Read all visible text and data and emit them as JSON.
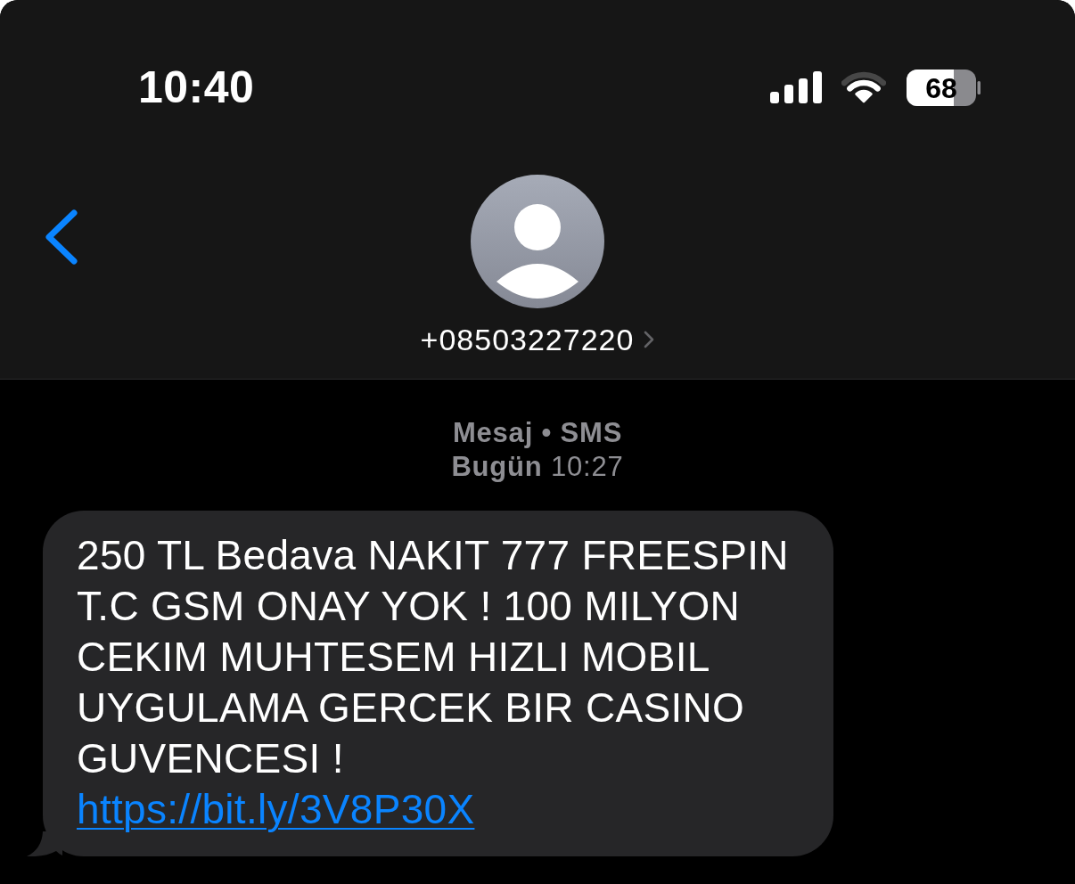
{
  "status_bar": {
    "time": "10:40",
    "battery": "68"
  },
  "header": {
    "contact": "+08503227220"
  },
  "conversation": {
    "service": "Mesaj • SMS",
    "timestamp": "**Bugün** 10:27",
    "messages": [
      {
        "kind": "incoming",
        "text": "250 TL Bedava NAKIT 777 FREESPIN T.C GSM ONAY YOK ! 100 MILYON CEKIM MUHTESEM HIZLI MOBIL UYGULAMA GERCEK BIR CASINO GUVENCESI !",
        "link": "https://bit.ly/3V8P30X"
      }
    ]
  }
}
